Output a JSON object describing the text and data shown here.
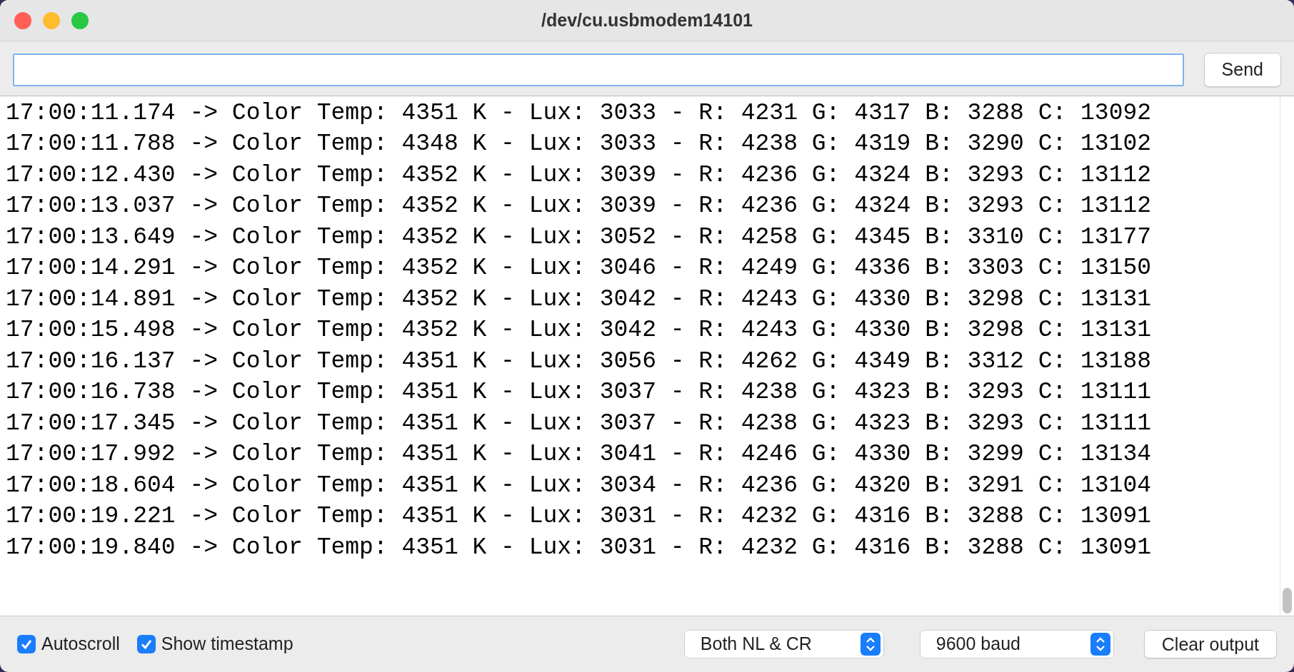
{
  "window": {
    "title": "/dev/cu.usbmodem14101"
  },
  "send_button": "Send",
  "output_lines": [
    "17:00:11.174 -> Color Temp: 4351 K - Lux: 3033 - R: 4231 G: 4317 B: 3288 C: 13092",
    "17:00:11.788 -> Color Temp: 4348 K - Lux: 3033 - R: 4238 G: 4319 B: 3290 C: 13102",
    "17:00:12.430 -> Color Temp: 4352 K - Lux: 3039 - R: 4236 G: 4324 B: 3293 C: 13112",
    "17:00:13.037 -> Color Temp: 4352 K - Lux: 3039 - R: 4236 G: 4324 B: 3293 C: 13112",
    "17:00:13.649 -> Color Temp: 4352 K - Lux: 3052 - R: 4258 G: 4345 B: 3310 C: 13177",
    "17:00:14.291 -> Color Temp: 4352 K - Lux: 3046 - R: 4249 G: 4336 B: 3303 C: 13150",
    "17:00:14.891 -> Color Temp: 4352 K - Lux: 3042 - R: 4243 G: 4330 B: 3298 C: 13131",
    "17:00:15.498 -> Color Temp: 4352 K - Lux: 3042 - R: 4243 G: 4330 B: 3298 C: 13131",
    "17:00:16.137 -> Color Temp: 4351 K - Lux: 3056 - R: 4262 G: 4349 B: 3312 C: 13188",
    "17:00:16.738 -> Color Temp: 4351 K - Lux: 3037 - R: 4238 G: 4323 B: 3293 C: 13111",
    "17:00:17.345 -> Color Temp: 4351 K - Lux: 3037 - R: 4238 G: 4323 B: 3293 C: 13111",
    "17:00:17.992 -> Color Temp: 4351 K - Lux: 3041 - R: 4246 G: 4330 B: 3299 C: 13134",
    "17:00:18.604 -> Color Temp: 4351 K - Lux: 3034 - R: 4236 G: 4320 B: 3291 C: 13104",
    "17:00:19.221 -> Color Temp: 4351 K - Lux: 3031 - R: 4232 G: 4316 B: 3288 C: 13091",
    "17:00:19.840 -> Color Temp: 4351 K - Lux: 3031 - R: 4232 G: 4316 B: 3288 C: 13091"
  ],
  "options": [
    {
      "label": "Autoscroll",
      "checked": true
    },
    {
      "label": "Show timestamp",
      "checked": true
    }
  ],
  "line_ending": {
    "value": "Both NL & CR"
  },
  "baud_rate": {
    "value": "9600 baud"
  },
  "clear_button": "Clear output"
}
